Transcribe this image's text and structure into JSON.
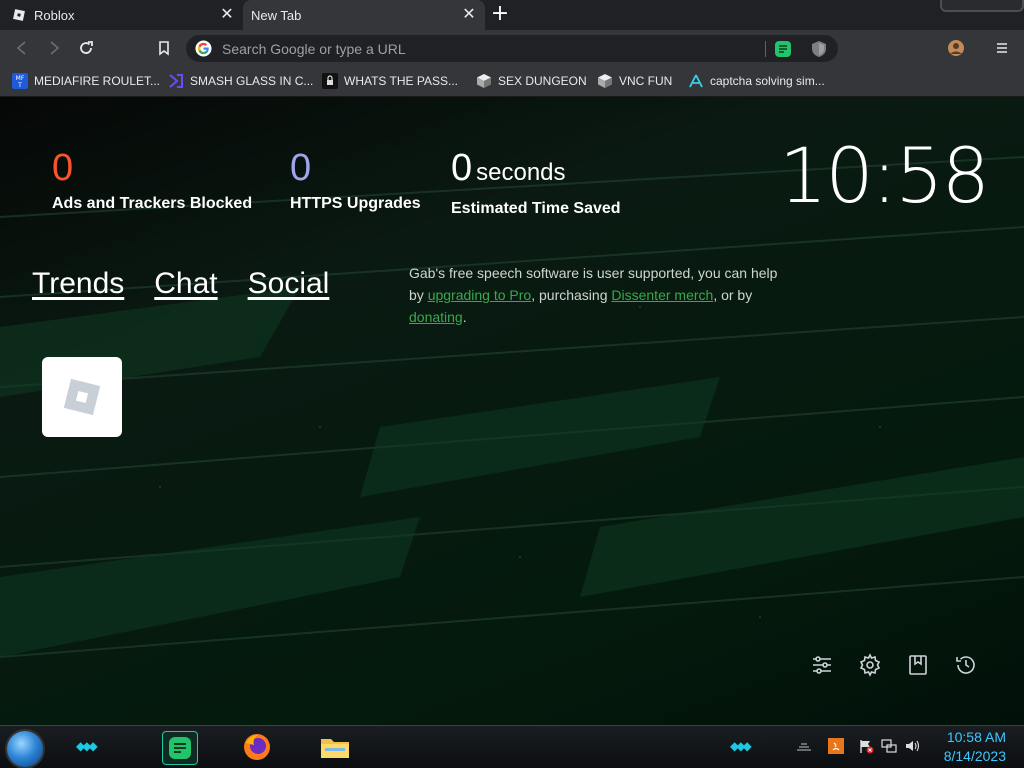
{
  "tabs": [
    {
      "title": "Roblox",
      "active": false
    },
    {
      "title": "New Tab",
      "active": true
    }
  ],
  "toolbar": {
    "omnibox_placeholder": "Search Google or type a URL"
  },
  "bookmarks": [
    {
      "label": "MEDIAFIRE ROULET...",
      "icon": "mediafire-icon"
    },
    {
      "label": "SMASH GLASS IN C...",
      "icon": "purple-bracket-icon"
    },
    {
      "label": "WHATS THE PASS...",
      "icon": "lock-icon"
    },
    {
      "label": "SEX DUNGEON",
      "icon": "cube-icon"
    },
    {
      "label": "VNC FUN",
      "icon": "cube-icon"
    },
    {
      "label": "captcha solving sim...",
      "icon": "triangle-icon"
    }
  ],
  "stats": {
    "ads_blocked": {
      "value": "0",
      "label": "Ads and Trackers Blocked",
      "color": "#fb542b"
    },
    "https_upgrades": {
      "value": "0",
      "label": "HTTPS Upgrades",
      "color": "#a0a5eb"
    },
    "time_saved": {
      "value": "0",
      "unit": "seconds",
      "label": "Estimated Time Saved",
      "color": "#ffffff"
    }
  },
  "clock": "10:58",
  "nav_links": [
    "Trends",
    "Chat",
    "Social"
  ],
  "promo": {
    "text1": "Gab's free speech software is user supported, you can help by ",
    "link1": "upgrading to Pro",
    "text2": ", purchasing ",
    "link2": "Dissenter merch",
    "text3": ", or by ",
    "link3": "donating",
    "text4": "."
  },
  "top_site": {
    "name": "Roblox",
    "icon": "roblox-icon"
  },
  "taskbar": {
    "time": "10:58 AM",
    "date": "8/14/2023",
    "apps": [
      "chat-app-icon",
      "firefox-icon",
      "file-explorer-icon"
    ]
  }
}
